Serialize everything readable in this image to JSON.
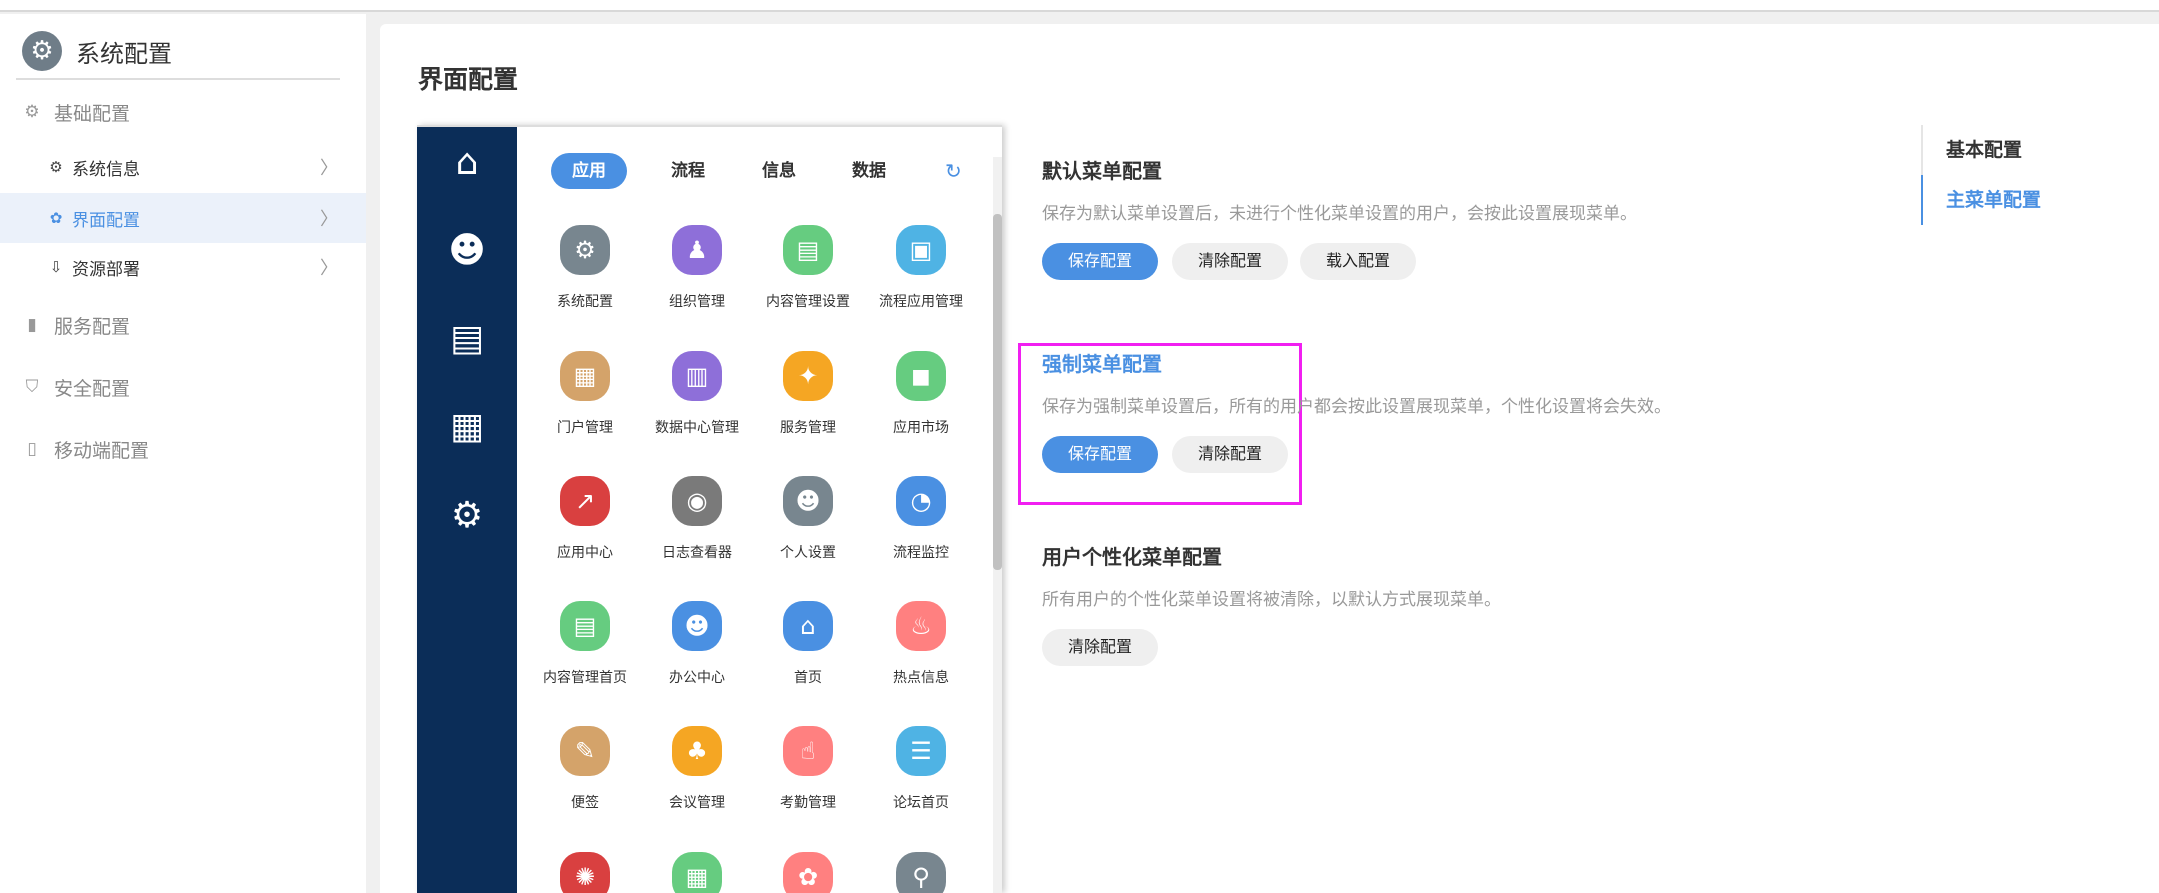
{
  "sidebar": {
    "title": "系统配置",
    "title_icon": "gear-icon",
    "items": [
      {
        "label": "基础配置",
        "icon": "gear-icon"
      },
      {
        "label": "系统信息",
        "icon": "gear-icon"
      },
      {
        "label": "界面配置",
        "icon": "palette-icon"
      },
      {
        "label": "资源部署",
        "icon": "deploy-icon"
      },
      {
        "label": "服务配置",
        "icon": "server-icon"
      },
      {
        "label": "安全配置",
        "icon": "shield-icon"
      },
      {
        "label": "移动端配置",
        "icon": "mobile-icon"
      }
    ]
  },
  "main": {
    "title": "界面配置",
    "preview": {
      "tabs": [
        "应用",
        "流程",
        "信息",
        "数据"
      ],
      "apps": [
        {
          "label": "系统配置",
          "color": "#78868f",
          "glyph": "⚙"
        },
        {
          "label": "组织管理",
          "color": "#8e6fd9",
          "glyph": "♟"
        },
        {
          "label": "内容管理设置",
          "color": "#66cc80",
          "glyph": "▤"
        },
        {
          "label": "流程应用管理",
          "color": "#4fb3e4",
          "glyph": "▣"
        },
        {
          "label": "门户管理",
          "color": "#d4a36a",
          "glyph": "▦"
        },
        {
          "label": "数据中心管理",
          "color": "#8e6fd9",
          "glyph": "▥"
        },
        {
          "label": "服务管理",
          "color": "#f5a623",
          "glyph": "✦"
        },
        {
          "label": "应用市场",
          "color": "#66cc80",
          "glyph": "◼"
        },
        {
          "label": "应用中心",
          "color": "#d94040",
          "glyph": "↗"
        },
        {
          "label": "日志查看器",
          "color": "#7a7a7a",
          "glyph": "◉"
        },
        {
          "label": "个人设置",
          "color": "#78868f",
          "glyph": "☻"
        },
        {
          "label": "流程监控",
          "color": "#4a90e2",
          "glyph": "◔"
        },
        {
          "label": "内容管理首页",
          "color": "#66cc80",
          "glyph": "▤"
        },
        {
          "label": "办公中心",
          "color": "#4a90e2",
          "glyph": "☻"
        },
        {
          "label": "首页",
          "color": "#4a90e2",
          "glyph": "⌂"
        },
        {
          "label": "热点信息",
          "color": "#ff8080",
          "glyph": "♨"
        },
        {
          "label": "便签",
          "color": "#d4a36a",
          "glyph": "✎"
        },
        {
          "label": "会议管理",
          "color": "#f5a623",
          "glyph": "♣"
        },
        {
          "label": "考勤管理",
          "color": "#ff8080",
          "glyph": "☝"
        },
        {
          "label": "论坛首页",
          "color": "#4fb3e4",
          "glyph": "☰"
        },
        {
          "label": "",
          "color": "#d94040",
          "glyph": "✺"
        },
        {
          "label": "",
          "color": "#66cc80",
          "glyph": "▦"
        },
        {
          "label": "",
          "color": "#ff8080",
          "glyph": "✿"
        },
        {
          "label": "",
          "color": "#78868f",
          "glyph": "⚲"
        }
      ]
    },
    "sections": [
      {
        "title": "默认菜单配置",
        "desc": "保存为默认菜单设置后，未进行个性化菜单设置的用户，会按此设置展现菜单。",
        "buttons": [
          "保存配置",
          "清除配置",
          "载入配置"
        ]
      },
      {
        "title": "强制菜单配置",
        "desc": "保存为强制菜单设置后，所有的用户都会按此设置展现菜单，个性化设置将会失效。",
        "buttons": [
          "保存配置",
          "清除配置"
        ]
      },
      {
        "title": "用户个性化菜单配置",
        "desc": "所有用户的个性化菜单设置将被清除，以默认方式展现菜单。",
        "buttons": [
          "清除配置"
        ]
      }
    ],
    "anchor_nav": [
      "基本配置",
      "主菜单配置"
    ]
  },
  "colors": {
    "accent": "#4a90e2",
    "nav_dark": "#0b2d58",
    "highlight": "#f11ff1"
  }
}
